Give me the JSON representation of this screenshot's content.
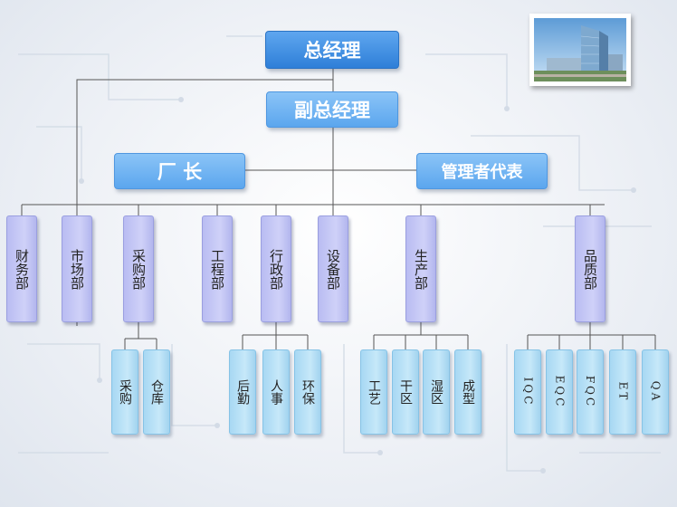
{
  "org": {
    "ceo": "总经理",
    "deputy": "副总经理",
    "factory_manager": "厂 长",
    "mgmt_rep": "管理者代表",
    "departments": [
      {
        "label": "财务部"
      },
      {
        "label": "市场部"
      },
      {
        "label": "采购部",
        "subs": [
          "采购",
          "仓库"
        ]
      },
      {
        "label": "工程部"
      },
      {
        "label": "行政部",
        "subs": [
          "后勤",
          "人事",
          "环保"
        ]
      },
      {
        "label": "设备部"
      },
      {
        "label": "生产部",
        "subs": [
          "工艺",
          "干区",
          "湿区",
          "成型"
        ]
      },
      {
        "label": "品质部",
        "subs": [
          "IQC",
          "EQC",
          "FQC",
          "ET",
          "QA"
        ]
      }
    ]
  },
  "colors": {
    "header_blue": "#2e7fd8",
    "dept_purple": "#c3c6f5",
    "sub_lightblue": "#b7e0f6",
    "line": "#555555"
  },
  "photo_icon": "office-building-photo"
}
